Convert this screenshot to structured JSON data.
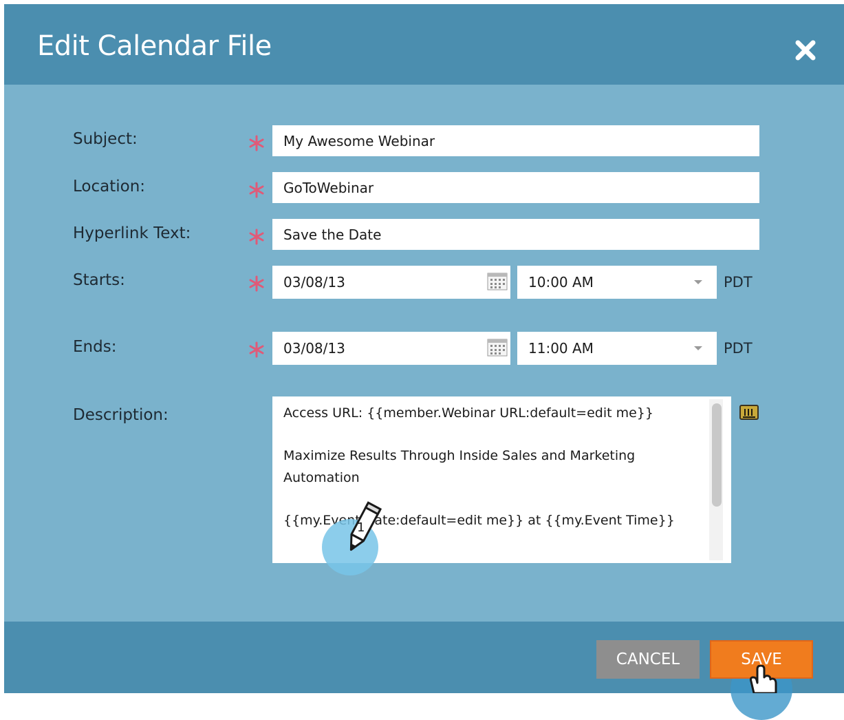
{
  "dialog": {
    "title": "Edit Calendar File",
    "close_icon": "close-icon"
  },
  "form": {
    "subject": {
      "label": "Subject:",
      "value": "My Awesome Webinar"
    },
    "location": {
      "label": "Location:",
      "value": "GoToWebinar"
    },
    "hyperlink_text": {
      "label": "Hyperlink Text:",
      "value": "Save the Date"
    },
    "starts": {
      "label": "Starts:",
      "date": "03/08/13",
      "time": "10:00 AM",
      "timezone": "PDT"
    },
    "ends": {
      "label": "Ends:",
      "date": "03/08/13",
      "time": "11:00 AM",
      "timezone": "PDT"
    },
    "description": {
      "label": "Description:",
      "lines": [
        "Access URL: {{member.Webinar URL:default=edit me}}",
        "Maximize Results Through Inside Sales and Marketing Automation",
        "{{my.Event Date:default=edit me}} at {{my.Event Time}}"
      ]
    }
  },
  "annotation": {
    "step_number": "1"
  },
  "footer": {
    "cancel_label": "CANCEL",
    "save_label": "SAVE"
  },
  "colors": {
    "header_bg": "#4b8eaf",
    "body_bg": "#7ab2cc",
    "save_bg": "#f07c1e",
    "cancel_bg": "#8e8e8e",
    "required_star": "#e05a78"
  }
}
